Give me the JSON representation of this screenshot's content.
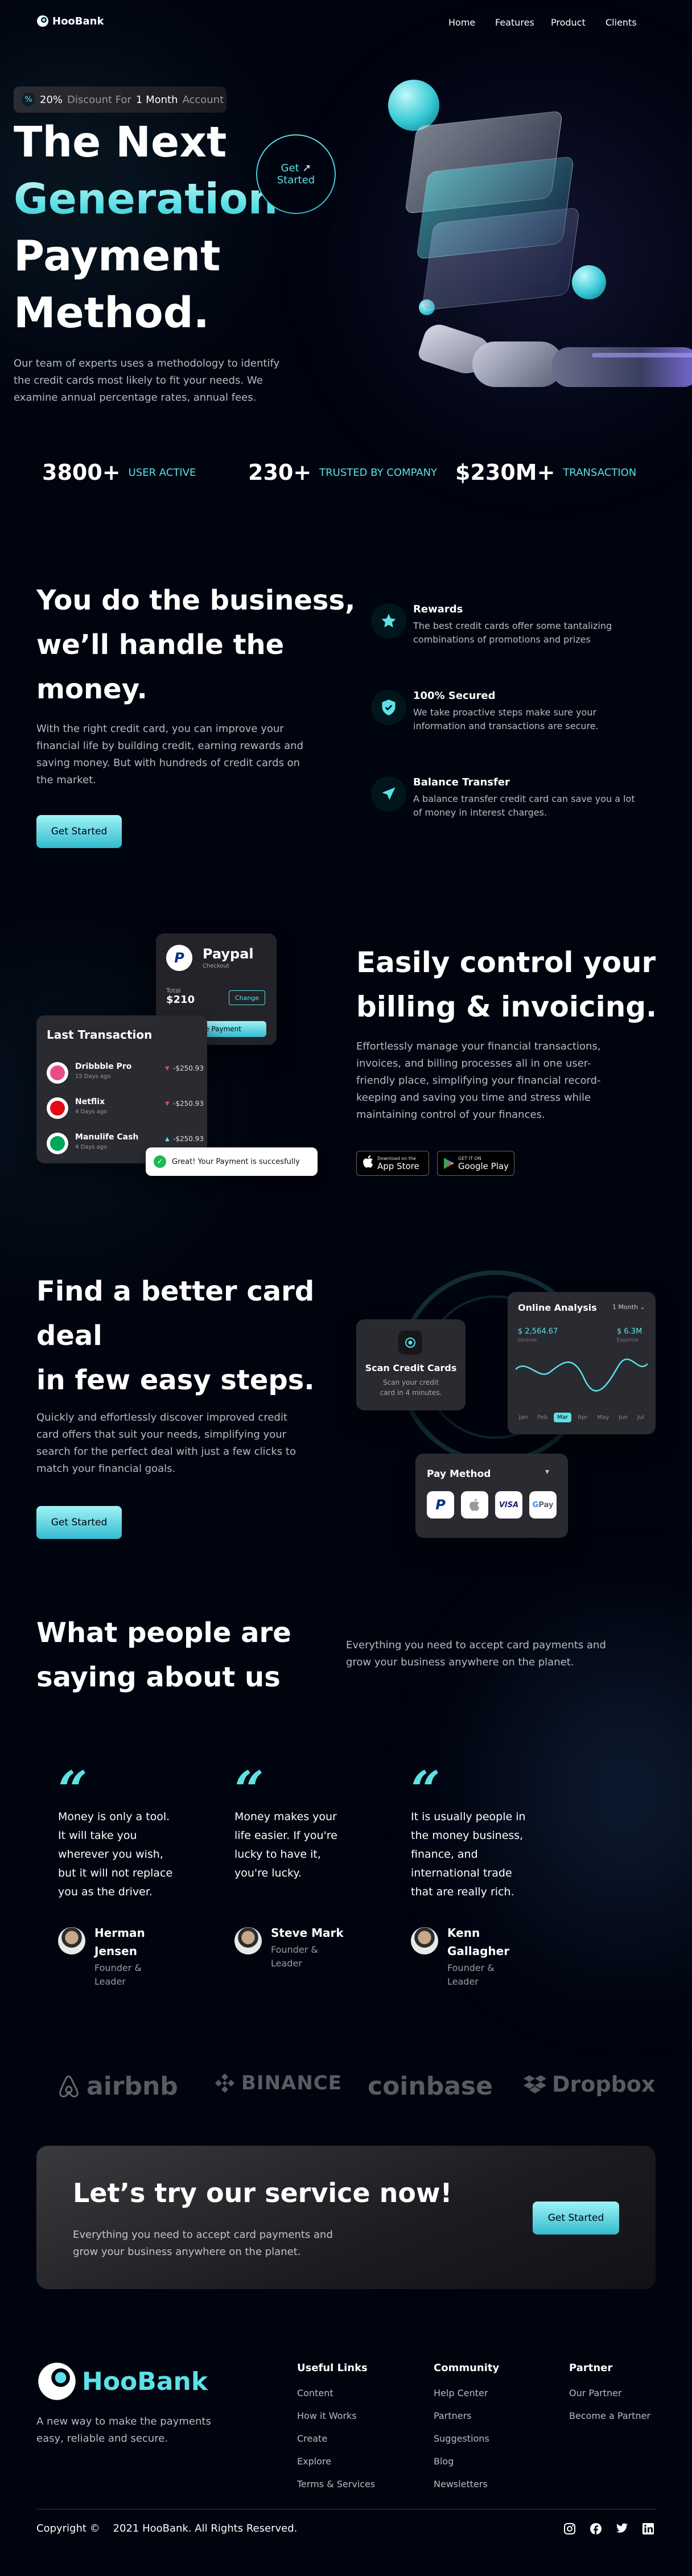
{
  "brand": {
    "name": "HooBank"
  },
  "nav": [
    {
      "label": "Home"
    },
    {
      "label": "Features"
    },
    {
      "label": "Product"
    },
    {
      "label": "Clients"
    }
  ],
  "hero": {
    "badge_pct": "20%",
    "badge_mid": "Discount For",
    "badge_month": "1 Month",
    "badge_end": "Account",
    "line1": "The Next",
    "line2": "Generation",
    "line3": "Payment",
    "line4": "Method.",
    "description": "Our team of experts uses a methodology to identify the credit cards most likely to fit your needs. We examine annual percentage rates, annual fees.",
    "get_started": "Get",
    "get_started2": "Started",
    "arrow": "↗"
  },
  "stats": [
    {
      "value": "3800+",
      "label": "USER ACTIVE"
    },
    {
      "value": "230+",
      "label": "TRUSTED BY COMPANY"
    },
    {
      "value": "$230M+",
      "label": "TRANSACTION"
    }
  ],
  "business": {
    "title1": "You do the business,",
    "title2": "we’ll handle the",
    "title3": "money.",
    "description": "With the right credit card, you can improve your financial life by building credit, earning rewards and saving money. But with hundreds of credit cards on the market.",
    "button": "Get Started",
    "features": [
      {
        "title": "Rewards",
        "desc": "The best credit cards offer some tantalizing combinations of promotions and prizes",
        "icon": "star-icon"
      },
      {
        "title": "100% Secured",
        "desc": "We take proactive steps make sure your information and transactions are secure.",
        "icon": "shield-icon"
      },
      {
        "title": "Balance Transfer",
        "desc": "A balance transfer credit card can save you a lot of money in interest charges.",
        "icon": "send-icon"
      }
    ]
  },
  "billing": {
    "title1": "Easily control your",
    "title2": "billing & invoicing.",
    "description": "Effortlessly manage your financial transactions, invoices, and billing processes all in one user-friendly place, simplifying your financial record-keeping and saving you time and stress while maintaining control of your finances.",
    "appstore_small": "Download on the",
    "appstore_big": "App Store",
    "gplay_small": "GET IT ON",
    "gplay_big": "Google Play",
    "paypal": {
      "title": "Paypal",
      "subtitle": "Checkout",
      "total_label": "Total",
      "total": "$210",
      "change": "Change",
      "make_payment": "Make Payment"
    },
    "transactions": {
      "title": "Last Transaction",
      "items": [
        {
          "name": "Dribbble Pro",
          "time": "15 Days ago",
          "amount": "-$250.93",
          "color": "#ea4c89",
          "arrow": "▼",
          "arrow_color": "#e24c4c"
        },
        {
          "name": "Netflix",
          "time": "4 Days ago",
          "amount": "-$250.93",
          "color": "#e50914",
          "arrow": "▼",
          "arrow_color": "#e24c4c"
        },
        {
          "name": "Manulife Cash",
          "time": "4 Days ago",
          "amount": "-$250.93",
          "color": "#00a758",
          "arrow": "▲",
          "arrow_color": "#5ce1e6"
        }
      ]
    },
    "toast": "Great! Your Payment is succesfully"
  },
  "steps": {
    "title1": "Find a better card",
    "title2": "deal",
    "title3": "in few easy steps.",
    "description": "Quickly and effortlessly discover improved credit card offers that suit your needs, simplifying your search for the perfect deal with just a few clicks to match your financial goals.",
    "button": "Get Started",
    "scan": {
      "title": "Scan Credit Cards",
      "desc": "Scan your credit card in 4 minutes."
    },
    "analysis": {
      "title": "Online Analysis",
      "period": "1 Month",
      "left_value": "$ 2,564.67",
      "left_label": "Income",
      "right_value": "$ 6.3M",
      "right_label": "Expense",
      "months": [
        "Jan",
        "Feb",
        "Mar",
        "Apr",
        "May",
        "Jun",
        "Jul"
      ],
      "active_month": "Mar"
    },
    "paymethod": {
      "title": "Pay Method",
      "visa": "VISA"
    }
  },
  "testimonials": {
    "title1": "What people are",
    "title2": "saying about us",
    "description": "Everything you need to accept card payments and grow your business anywhere on the planet.",
    "items": [
      {
        "lines": [
          "Money is only a tool.",
          "It will take you",
          "wherever you wish,",
          "but it will not replace",
          "you as the driver."
        ],
        "name1": "Herman",
        "name2": "Jensen",
        "role1": "Founder &",
        "role2": "Leader"
      },
      {
        "lines": [
          "Money makes your",
          "life easier. If you're",
          "lucky to have it,",
          "you're lucky."
        ],
        "name1": "Steve Mark",
        "name2": "",
        "role1": "Founder &",
        "role2": "Leader"
      },
      {
        "lines": [
          "It is usually people in",
          "the money business,",
          "finance, and",
          "international trade",
          "that are really rich."
        ],
        "name1": "Kenn",
        "name2": "Gallagher",
        "role1": "Founder &",
        "role2": "Leader"
      }
    ]
  },
  "clients": [
    {
      "name": "airbnb"
    },
    {
      "name": "BINANCE"
    },
    {
      "name": "coinbase"
    },
    {
      "name": "Dropbox"
    }
  ],
  "cta": {
    "title": "Let’s try our service now!",
    "description": "Everything you need to accept card payments and grow your business anywhere on the planet.",
    "button": "Get Started"
  },
  "footer": {
    "tagline": "A new way to make the payments easy, reliable and secure.",
    "columns": [
      {
        "title": "Useful Links",
        "links": [
          "Content",
          "How it Works",
          "Create",
          "Explore",
          "Terms & Services"
        ]
      },
      {
        "title": "Community",
        "links": [
          "Help Center",
          "Partners",
          "Suggestions",
          "Blog",
          "Newsletters"
        ]
      },
      {
        "title": "Partner",
        "links": [
          "Our Partner",
          "Become a Partner"
        ]
      }
    ],
    "copyright": "Copyright ©    2021 HooBank. All Rights Reserved."
  },
  "colors": {
    "accent": "#5ce1e6",
    "background": "#00040f"
  }
}
